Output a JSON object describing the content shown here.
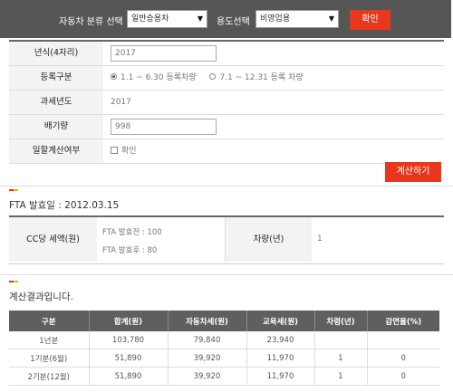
{
  "top_bar": {
    "vehicle_type_label": "자동차 분류 선택",
    "vehicle_type_value": "일반승용차",
    "usage_label": "용도선택",
    "usage_value": "비영업용",
    "confirm_label": "확인",
    "colors": {
      "bar_bg": "#565656",
      "accent": "#e8371c"
    }
  },
  "form": {
    "year": {
      "label": "년식(4자리)",
      "value": "2017"
    },
    "registration": {
      "label": "등록구분",
      "option_1": "1.1 ~ 6.30 등록차량",
      "option_2": "7.1 ~ 12.31 등록 차량",
      "selected": "option_1"
    },
    "tax_year": {
      "label": "과세년도",
      "value": "2017"
    },
    "displacement": {
      "label": "배기량",
      "value": "998"
    },
    "lump_sum": {
      "label": "일할계산여부",
      "checkbox_label": "확인",
      "checked": false
    }
  },
  "calc_button": "계산하기",
  "fta": {
    "title": "FTA 발효일 : 2012.03.15",
    "cc_tax_label": "CC당 세액(원)",
    "before": "FTA 발효전 : 100",
    "after": "FTA 발효후 : 80",
    "vehicle_age_label": "차량(년)",
    "vehicle_age_value": "1"
  },
  "result": {
    "title": "계산결과입니다.",
    "headers": [
      "구분",
      "합계(원)",
      "자동차세(원)",
      "교육세(원)",
      "차령(년)",
      "감면율(%)"
    ],
    "rows": [
      [
        "1년분",
        "103,780",
        "79,840",
        "23,940",
        "",
        ""
      ],
      [
        "1기분(6월)",
        "51,890",
        "39,920",
        "11,970",
        "1",
        "0"
      ],
      [
        "2기분(12월)",
        "51,890",
        "39,920",
        "11,970",
        "1",
        "0"
      ]
    ]
  }
}
